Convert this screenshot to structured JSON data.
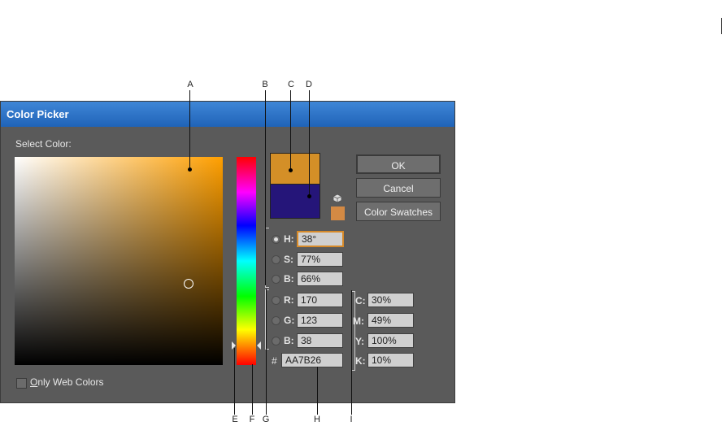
{
  "callouts": {
    "A": "A",
    "B": "B",
    "C": "C",
    "D": "D",
    "E": "E",
    "F": "F",
    "G": "G",
    "H": "H",
    "I": "I"
  },
  "dialog": {
    "title": "Color Picker",
    "select_color_label": "Select Color:",
    "only_web_colors_label": "Only Web Colors",
    "only_web_colors_mnemonic": "O",
    "only_web_colors_rest": "nly Web Colors",
    "only_web_colors_checked": false,
    "hue_slider_value_fraction": 0.89
  },
  "swatches": {
    "new_color": "#d48f27",
    "current_color": "#251579",
    "web_safe_warning": "#d48a44"
  },
  "buttons": {
    "ok": "OK",
    "cancel": "Cancel",
    "color_swatches": "Color Swatches"
  },
  "hsb": {
    "h": {
      "label": "H:",
      "value": "38°",
      "selected": true
    },
    "s": {
      "label": "S:",
      "value": "77%",
      "selected": false
    },
    "b": {
      "label": "B:",
      "value": "66%",
      "selected": false
    }
  },
  "rgb": {
    "r": {
      "label": "R:",
      "value": "170"
    },
    "g": {
      "label": "G:",
      "value": "123"
    },
    "b": {
      "label": "B:",
      "value": "38"
    }
  },
  "hex": {
    "label": "#",
    "value": "AA7B26"
  },
  "cmyk": {
    "c": {
      "label": "C:",
      "value": "30%"
    },
    "m": {
      "label": "M:",
      "value": "49%"
    },
    "y": {
      "label": "Y:",
      "value": "100%"
    },
    "k": {
      "label": "K:",
      "value": "10%"
    }
  },
  "icons": {
    "gamut_cube": "cube-icon"
  }
}
